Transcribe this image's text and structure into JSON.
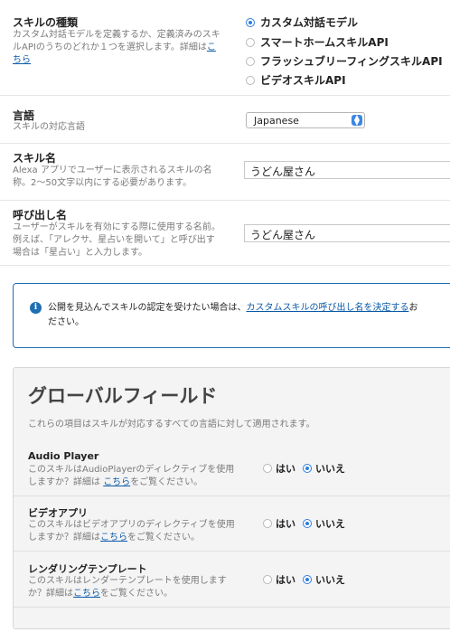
{
  "skill_type": {
    "label": "スキルの種類",
    "desc_line1": "カスタム対話モデルを定義するか、定義済みのスキ",
    "desc_line2_pre": "ルAPIのうちのどれか１つを選択します。詳細は",
    "desc_line2_link": "こ",
    "desc_line3_link": "ちら",
    "options": [
      {
        "label": "カスタム対話モデル",
        "selected": true
      },
      {
        "label": "スマートホームスキルAPI",
        "selected": false
      },
      {
        "label": "フラッシュブリーフィングスキルAPI",
        "selected": false
      },
      {
        "label": "ビデオスキルAPI",
        "selected": false
      }
    ]
  },
  "language": {
    "label": "言語",
    "desc": "スキルの対応言語",
    "value": "Japanese"
  },
  "skill_name": {
    "label": "スキル名",
    "desc_line1": "Alexa アプリでユーザーに表示されるスキルの名",
    "desc_line2": "称。2〜50文字以内にする必要があります。",
    "value": "うどん屋さん"
  },
  "invocation_name": {
    "label": "呼び出し名",
    "desc_line1": "ユーザーがスキルを有効にする際に使用する名前。",
    "desc_line2": "例えば、「アレクサ、星占いを開いて」と呼び出す",
    "desc_line3": "場合は「星占い」と入力します。",
    "value": "うどん屋さん"
  },
  "notice": {
    "line1_pre": "公開を見込んでスキルの認定を受けたい場合は、",
    "line1_link": "カスタムスキルの呼び出し名を決定する",
    "line1_post": "お",
    "line2": "ださい。"
  },
  "global": {
    "title": "グローバルフィールド",
    "desc": "これらの項目はスキルが対応するすべての言語に対して適用されます。",
    "yes_label": "はい",
    "no_label": "いいえ",
    "items": [
      {
        "label": "Audio Player",
        "desc_line1": "このスキルはAudioPlayerのディレクティブを使用",
        "desc_line2_pre": "しますか？詳細は ",
        "desc_line2_link": "こちら",
        "desc_line2_post": "をご覧ください。",
        "value": "no"
      },
      {
        "label": "ビデオアプリ",
        "desc_line1": "このスキルはビデオアプリのディレクティブを使用",
        "desc_line2_pre": "しますか？詳細は",
        "desc_line2_link": "こちら",
        "desc_line2_post": "をご覧ください。",
        "value": "no"
      },
      {
        "label": "レンダリングテンプレート",
        "desc_line1": "このスキルはレンダーテンプレートを使用します",
        "desc_line2_pre": "か？詳細は",
        "desc_line2_link": "こちら",
        "desc_line2_post": "をご覧ください。",
        "value": "no"
      }
    ]
  },
  "colors": {
    "accent": "#2d7de0",
    "link": "#0a5aa8",
    "notice_border": "#1f6fb4"
  }
}
